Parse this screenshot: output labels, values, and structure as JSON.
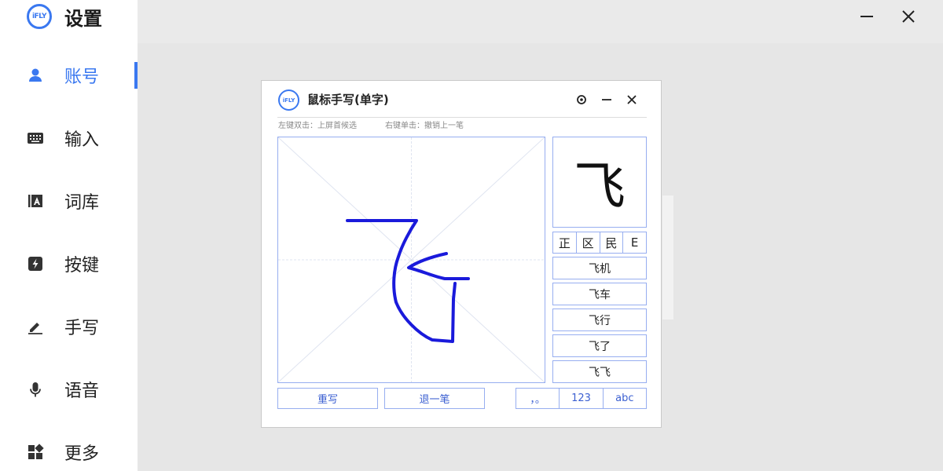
{
  "app": {
    "logo_text": "iFLY",
    "title": "设置"
  },
  "window_controls": {
    "minimize": "minimize-icon",
    "close": "close-icon"
  },
  "sidebar": {
    "items": [
      {
        "label": "账号",
        "icon": "user-icon",
        "active": true
      },
      {
        "label": "输入",
        "icon": "keyboard-icon"
      },
      {
        "label": "词库",
        "icon": "dictionary-icon"
      },
      {
        "label": "按键",
        "icon": "lightning-icon"
      },
      {
        "label": "手写",
        "icon": "pen-icon"
      },
      {
        "label": "语音",
        "icon": "microphone-icon"
      },
      {
        "label": "更多",
        "icon": "grid-icon"
      }
    ]
  },
  "colors": {
    "accent": "#3a78f0",
    "stroke": "#1a1adb",
    "border": "#97aef0"
  },
  "handwriting": {
    "logo_text": "iFLY",
    "title": "鼠标手写(单字)",
    "tools": [
      "target-icon",
      "minimize-icon",
      "close-icon"
    ],
    "hint_left": "左键双击：上屏首候选",
    "hint_right": "右键单击：撤销上一笔",
    "preview_char": "飞",
    "char_candidates": [
      "正",
      "区",
      "民",
      "E"
    ],
    "word_candidates": [
      "飞机",
      "飞车",
      "飞行",
      "飞了",
      "飞飞"
    ],
    "buttons": {
      "rewrite": "重写",
      "undo": "退一笔"
    },
    "modes": [
      "，。",
      "123",
      "abc"
    ]
  }
}
